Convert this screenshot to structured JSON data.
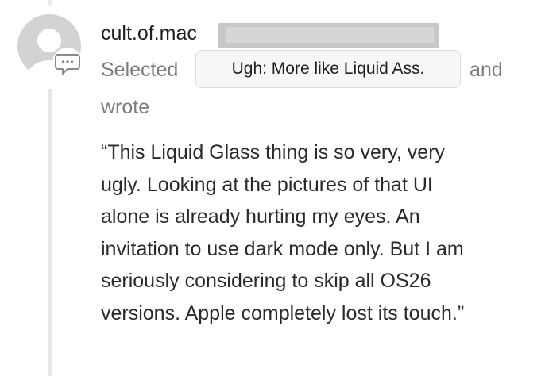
{
  "post": {
    "username": "cult.of.mac",
    "action_selected": "Selected",
    "highlight_tag": "Ugh: More like Liquid Ass.",
    "action_and": "and",
    "action_wrote": "wrote",
    "quote_lines": [
      "“This Liquid Glass thing is so very, very",
      "ugly. Looking at the pictures of that UI",
      "alone is already hurting my eyes. An",
      "invitation to use dark mode only. But I am",
      "seriously considering to skip all OS26",
      "versions. Apple completely lost its touch.”"
    ]
  },
  "icons": {
    "avatar": "default-avatar-icon",
    "badge": "comment-bubble-icon"
  },
  "colors": {
    "text_primary": "#1f1f1f",
    "text_secondary": "#7c7c7c",
    "tag_background": "#f6f7f9",
    "tag_border": "#d9dde2",
    "thread_line": "#e6e6e6",
    "redaction": "#c8c8c8"
  }
}
